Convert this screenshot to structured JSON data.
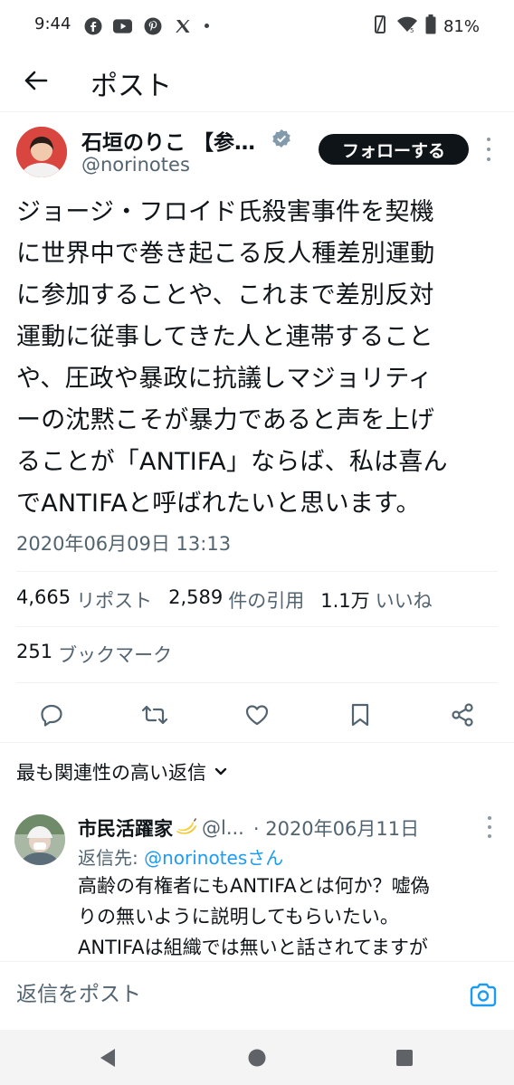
{
  "status_bar": {
    "time": "9:44",
    "battery": "81%",
    "apps": [
      "facebook-icon",
      "youtube-icon",
      "pinterest-icon",
      "x-icon"
    ]
  },
  "header": {
    "title": "ポスト"
  },
  "author": {
    "name": "石垣のりこ 【参…",
    "handle": "@norinotes",
    "follow_label": "フォローする"
  },
  "tweet": {
    "text": "ジョージ・フロイド氏殺害事件を契機\nに世界中で巻き起こる反人種差別運動\nに参加することや、これまで差別反対\n運動に従事してきた人と連帯すること\nや、圧政や暴政に抗議しマジョリティ\nーの沈黙こそが暴力であると声を上げ\nることが「ANTIFA」ならば、私は喜ん\nでANTIFAと呼ばれたいと思います。",
    "timestamp": "2020年06月09日 13:13"
  },
  "stats": {
    "reposts_count": "4,665",
    "reposts_label": "リポスト",
    "quotes_count": "2,589",
    "quotes_label": "件の引用",
    "likes_count": "1.1万",
    "likes_label": "いいね",
    "bookmarks_count": "251",
    "bookmarks_label": "ブックマーク"
  },
  "replies": {
    "sort_label": "最も関連性の高い返信",
    "items": [
      {
        "name": "市民活躍家",
        "handle": "@l...",
        "date": "· 2020年06月11日",
        "reply_to_prefix": "返信先: ",
        "reply_to_handle": "@norinotesさん",
        "text": "高齢の有権者にもANTIFAとは何か？嘘偽\nりの無いように説明してもらいたい。\nANTIFAは組織では無いと話されてますが"
      }
    ]
  },
  "compose": {
    "placeholder": "返信をポスト"
  },
  "colors": {
    "accent": "#1d9bf0",
    "text": "#0f1419",
    "secondary": "#536471",
    "follow_bg": "#0f1419"
  }
}
